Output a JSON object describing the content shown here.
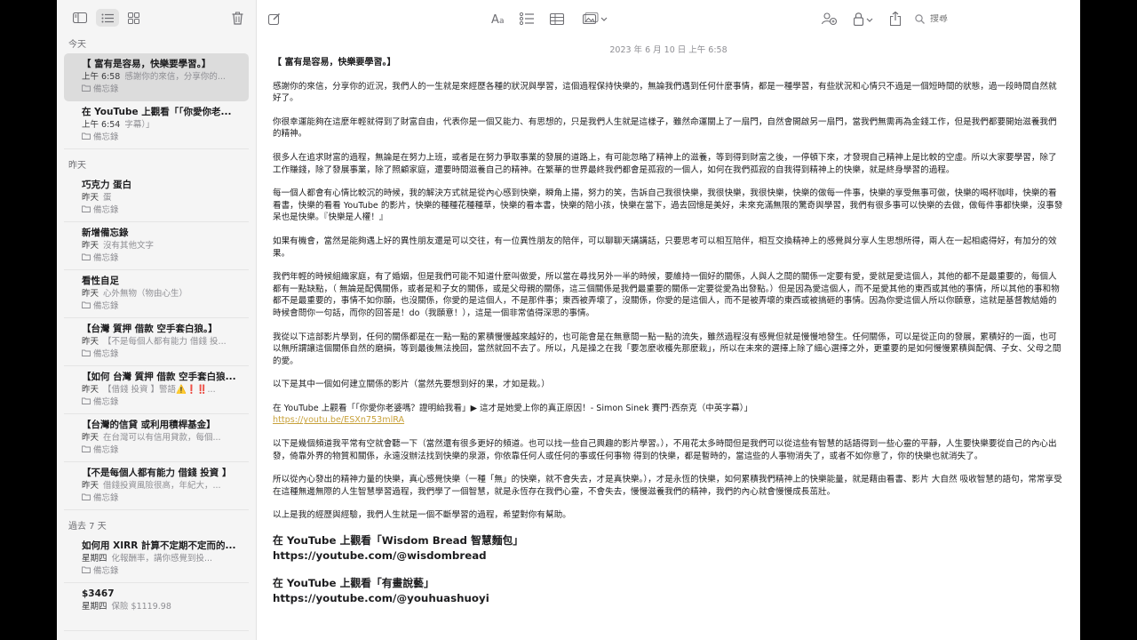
{
  "sidebar": {
    "sections": [
      {
        "header": "今天",
        "notes": [
          {
            "title": "【 富有是容易，快樂要學習。】",
            "time": "上午 6:58",
            "preview": "感謝你的來信，分享你的...",
            "folder": "備忘錄",
            "active": true
          },
          {
            "title": "在 YouTube 上觀看「「你愛你老...",
            "time": "上午 6:54",
            "preview": "字幕）」",
            "folder": "備忘錄"
          }
        ]
      },
      {
        "header": "昨天",
        "notes": [
          {
            "title": "巧克力 蛋白",
            "time": "昨天",
            "preview": "蛋",
            "folder": "備忘錄"
          },
          {
            "title": "新增備忘錄",
            "time": "昨天",
            "preview": "沒有其他文字",
            "folder": "備忘錄"
          },
          {
            "title": "看性自足",
            "time": "昨天",
            "preview": "心外無物（物由心生）",
            "folder": "備忘錄"
          },
          {
            "title": "【台灣 質押 借款 空手套白狼。】",
            "time": "昨天",
            "preview": "【不是每個人都有能力 借錢 投...",
            "folder": "備忘錄"
          },
          {
            "title": "【如何 台灣 質押 借款 空手套白狼...",
            "time": "昨天",
            "preview": "【借錢 投資 】警語⚠️❗️‼️...",
            "folder": "備忘錄"
          },
          {
            "title": "【台灣的信貸 或利用積桿基金】",
            "time": "昨天",
            "preview": "在台灣可以有信用貸款，每個...",
            "folder": "備忘錄"
          },
          {
            "title": "【不是每個人都有能力 借錢 投資 】",
            "time": "昨天",
            "preview": "借錢投資風險很高，年紀大，...",
            "folder": "備忘錄"
          }
        ]
      },
      {
        "header": "過去 7 天",
        "notes": [
          {
            "title": "如何用 XIRR 計算不定期不定而的...",
            "time": "星期四",
            "preview": "化報酬率，講你感覺到投...",
            "folder": "備忘錄"
          },
          {
            "title": "$3467",
            "time": "星期四",
            "preview": "保險 $1119.98",
            "folder": ""
          }
        ]
      }
    ]
  },
  "editor": {
    "date": "2023 年 6 月 10 日 上午 6:58",
    "search_placeholder": "搜尋",
    "title": "【 富有是容易，快樂要學習。】",
    "paragraphs": [
      "感謝你的來信，分享你的近況，我們人的一生就是來經歷各種的狀況與學習，這個過程保持快樂的，無論我們遇到任何什麼事情，都是一種學習，有些狀況和心情只不過是一個短時間的狀態，過一段時間自然就好了。",
      "你很幸運能夠在這麼年輕就得到了財富自由，代表你是一個又能力、有思想的，只是我們人生就是這樣子，雖然命運關上了一扇門，自然會開啟另一扇門，當我們無需再為金錢工作，但是我們都要開始滋養我們的精神。",
      "很多人在追求財富的過程，無論是在努力上班，或者是在努力爭取事業的發展的道路上，有可能忽略了精神上的滋養，等到得到財富之後，一停頓下來，才發現自己精神上是比較的空虛。所以大家要學習，除了工作賺錢，除了發展事業，除了照顧家庭，還要時間滋養自己的精神。在繁華的世界最終我們都會是孤寂的一個人，如何在我們孤寂的自我得到精神上的快樂，就是終身學習的過程。",
      "每一個人都會有心情比較沉的時候，我的解決方式就是從內心感到快樂，瞬角上揚，努力的笑，告訴自己我很快樂，我很快樂，我很快樂，快樂的做每一件事，快樂的享受無事可做，快樂的喝杯咖啡，快樂的看看書，快樂的看看 YouTube 的影片，快樂的種種花種種草，快樂的看本書，快樂的陪小孩，快樂在當下，過去回憶是美好，未來充滿無限的驚奇與學習，我們有很多事可以快樂的去做，做每件事都快樂，沒事發呆也是快樂。『快樂是人權！』",
      "如果有機會，當然是能夠遇上好的異性朋友還是可以交往，有一位異性朋友的陪伴，可以聊聊天講講話，只要思考可以相互陪伴，相互交換精神上的感覺與分享人生思想所得，兩人在一起相處得好，有加分的效果。",
      "我們年輕的時候組織家庭，有了婚姻，但是我們可能不知道什麼叫做愛，所以當在尋找另外一半的時候，要維持一個好的關係，人與人之間的關係一定要有愛，愛就是愛這個人，其他的都不是最重要的，每個人都有一點缺點，（ 無論是配偶關係，或者是和子女的關係，或是父母親的關係，這三個關係是我們最重要的關係一定要從愛為出發點。）但是因為愛這個人，而不是愛其他的東西或其他的事情，所以其他的事和物都不是最重要的，事情不如你願，也沒關係，你愛的是這個人，不是那件事；東西被弄壞了，沒關係，你愛的是這個人，而不是被弄壞的東西或被搞砸的事情。因為你愛這個人所以你願意，這就是基督教結婚的時候會問你一句話，而你的回答是！do（我願意！），這是一個非常值得深思的事情。",
      "我從以下這部影片學到，任何的關係都是在一點一點的累積慢慢越來越好的，也可能會是在無意間一點一點的流失，雖然過程沒有感覺但就是慢慢地發生。任何關係，可以是從正向的發展，累積好的一面，也可以無所謂讓這個關係自然的磨損，等到最後無法挽回，當然就回不去了。所以，凡是操之在我「要怎麼收穫先那麼栽」，所以在未來的選擇上除了細心選擇之外，更重要的是如何慢慢累積與配偶、子女、父母之間的愛。",
      "以下是其中一個如何建立關係的影片（當然先要想到好的果，才如是栽。）"
    ],
    "video_line": "在 YouTube 上觀看「「你愛你老婆嗎？證明給我看」▶ 這才是她愛上你的真正原因！- Simon Sinek 賽門‧西奈克（中英字幕）」",
    "video_url": "https://youtu.be/ESXn753mlRA",
    "paragraphs2": [
      "以下是幾個頻道我平常有空就會聽一下（當然還有很多更好的頻道。也可以找一些自己興趣的影片學習。），不用花太多時間但是我們可以從這些有智慧的話語得到一些心靈的平靜，人生要快樂要從自己的內心出發，倚靠外界的物質和關係，永遠沒辦法找到快樂的泉源，你依靠任何人或任何的事或任何事物 得到的快樂，都是暫時的，當這些的人事物消失了，或者不如你意了，你的快樂也就消失了。",
      "所以從內心發出的精神力量的快樂，真心感覺快樂（一種「無」的快樂，就不會失去，才是真快樂。），才是永恆的快樂，如何累積我們精神上的快樂能量，就是藉由看書、影片 大自然 吸收智慧的語句，常常享受在這種無邊無際的人生智慧學習過程，我們學了一個智慧，就是永恆存在我們心靈，不會失去，慢慢滋養我們的精神，我們的內心就會慢慢成長茁壯。",
      "以上是我的經歷與經驗，我們人生就是一個不斷學習的過程，希望對你有幫助。"
    ],
    "channels": [
      {
        "line": "在 YouTube 上觀看「Wisdom Bread 智慧麵包」",
        "url": "https://youtube.com/@wisdombread"
      },
      {
        "line": "在 YouTube 上觀看「有畫說藝」",
        "url": "https://youtube.com/@youhuashuoyi"
      }
    ]
  },
  "icons": {
    "sidebar_toggle": "sidebar-icon",
    "list_view": "list-view-icon",
    "gallery_view": "gallery-view-icon",
    "delete": "trash-icon",
    "compose": "compose-icon",
    "format": "format-text-icon",
    "checklist": "checklist-icon",
    "table": "table-icon",
    "media": "media-icon",
    "collaborate": "collaborate-icon",
    "lock": "lock-icon",
    "share": "share-icon",
    "search": "search-icon"
  },
  "colors": {
    "link": "#c8a23c",
    "selected_note": "#dcdcdc",
    "sidebar_bg": "#f5f5f5"
  }
}
